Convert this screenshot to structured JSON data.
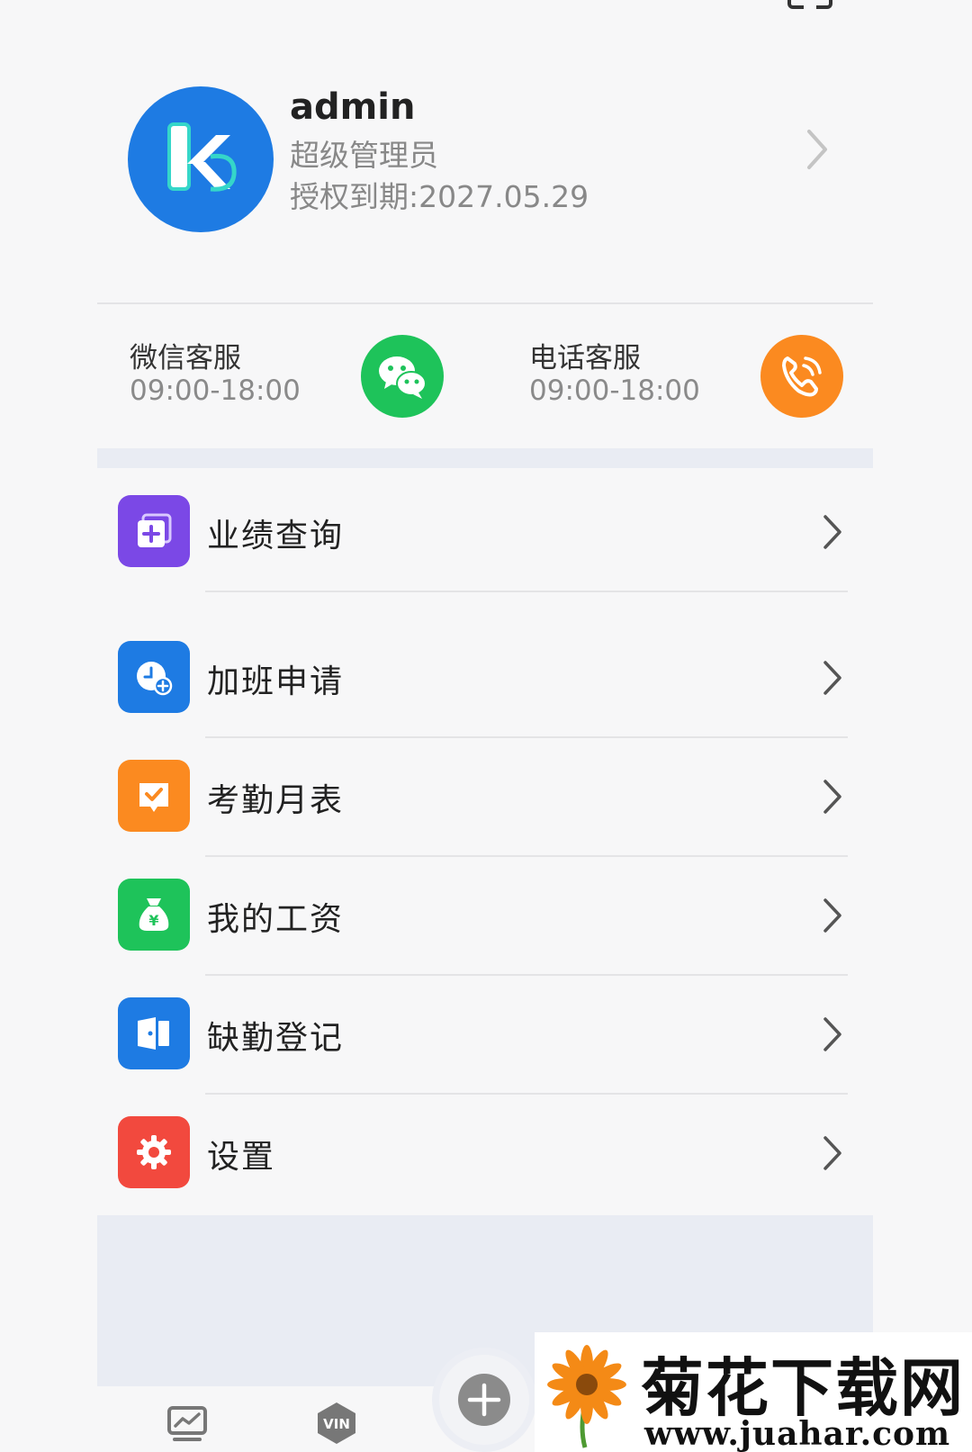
{
  "profile": {
    "name": "admin",
    "role": "超级管理员",
    "expiry": "授权到期:2027.05.29"
  },
  "support": {
    "wechat": {
      "title": "微信客服",
      "hours": "09:00-18:00"
    },
    "phone": {
      "title": "电话客服",
      "hours": "09:00-18:00"
    }
  },
  "menu": {
    "items": [
      {
        "label": "业绩查询",
        "icon": "performance-icon",
        "color": "#7b48e6"
      },
      {
        "label": "加班申请",
        "icon": "overtime-clock-icon",
        "color": "#1e7be3"
      },
      {
        "label": "考勤月表",
        "icon": "attendance-check-icon",
        "color": "#fb8a20"
      },
      {
        "label": "我的工资",
        "icon": "salary-moneybag-icon",
        "color": "#1ec35a"
      },
      {
        "label": "缺勤登记",
        "icon": "absence-door-icon",
        "color": "#1e7be3"
      },
      {
        "label": "设置",
        "icon": "settings-gear-icon",
        "color": "#f2493e"
      }
    ]
  },
  "nav": {
    "vin_label": "VIN"
  },
  "watermark": {
    "title": "菊花下载网",
    "url": "www.juahar.com"
  }
}
